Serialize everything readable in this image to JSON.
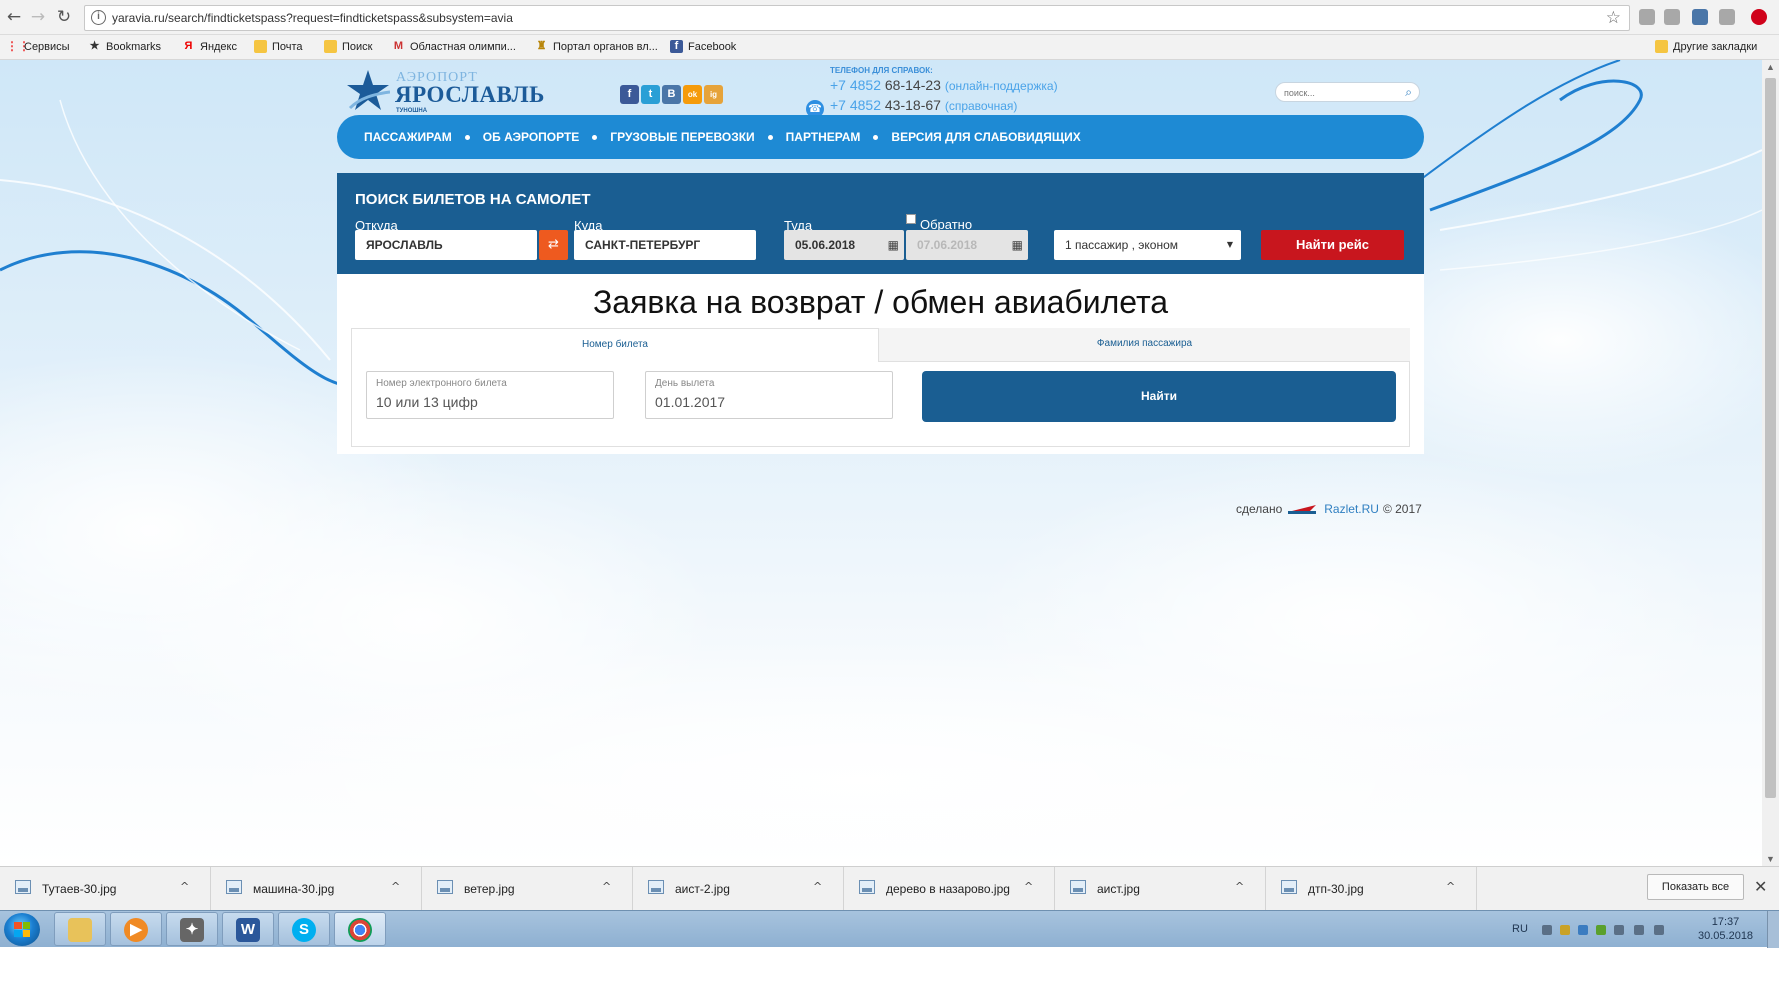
{
  "browser": {
    "url": "yaravia.ru/search/findticketspass?request=findticketspass&subsystem=avia",
    "bookmarks": [
      "Сервисы",
      "Bookmarks",
      "Яндекс",
      "Почта",
      "Поиск",
      "Областная олимпи...",
      "Портал органов вл...",
      "Facebook"
    ],
    "other_bookmarks": "Другие закладки"
  },
  "site": {
    "logo_top": "АЭРОПОРТ",
    "logo_name": "ЯРОСЛАВЛЬ",
    "logo_sub": "ТУНОШНА",
    "social": [
      "f",
      "t",
      "B",
      "ok",
      "ig"
    ],
    "phones_title": "ТЕЛЕФОН ДЛЯ СПРАВОК:",
    "phone1_code": "+7 4852",
    "phone1_num": "68-14-23",
    "phone1_note": "(онлайн-поддержка)",
    "phone2_code": "+7 4852",
    "phone2_num": "43-18-67",
    "phone2_note": "(справочная)",
    "search_placeholder": "поиск..."
  },
  "menu": [
    "ПАССАЖИРАМ",
    "ОБ АЭРОПОРТЕ",
    "ГРУЗОВЫЕ ПЕРЕВОЗКИ",
    "ПАРТНЕРАМ",
    "ВЕРСИЯ ДЛЯ СЛАБОВИДЯЩИХ"
  ],
  "ticket_search": {
    "title": "ПОИСК БИЛЕТОВ НА САМОЛЕТ",
    "from_label": "Откуда",
    "from_value": "ЯРОСЛАВЛЬ",
    "to_label": "Куда",
    "to_value": "САНКТ-ПЕТЕРБУРГ",
    "there_label": "Туда",
    "there_value": "05.06.2018",
    "back_label": "Обратно",
    "back_value": "07.06.2018",
    "passengers": "1 пассажир , эконом",
    "find_button": "Найти рейс"
  },
  "refund": {
    "title": "Заявка на возврат / обмен авиабилета",
    "tab_ticket": "Номер билета",
    "tab_surname": "Фамилия пассажира",
    "ticket_label": "Номер электронного билета",
    "ticket_placeholder": "10 или 13 цифр",
    "date_label": "День вылета",
    "date_value": "01.01.2017",
    "find_button": "Найти"
  },
  "credit": {
    "made": "сделано",
    "link": "Razlet.RU",
    "year": "© 2017"
  },
  "downloads": {
    "files": [
      "Тутаев-30.jpg",
      "машина-30.jpg",
      "ветер.jpg",
      "аист-2.jpg",
      "дерево в назарово.jpg",
      "аист.jpg",
      "дтп-30.jpg"
    ],
    "show_all": "Показать все"
  },
  "taskbar": {
    "lang": "RU",
    "time": "17:37",
    "date": "30.05.2018"
  }
}
